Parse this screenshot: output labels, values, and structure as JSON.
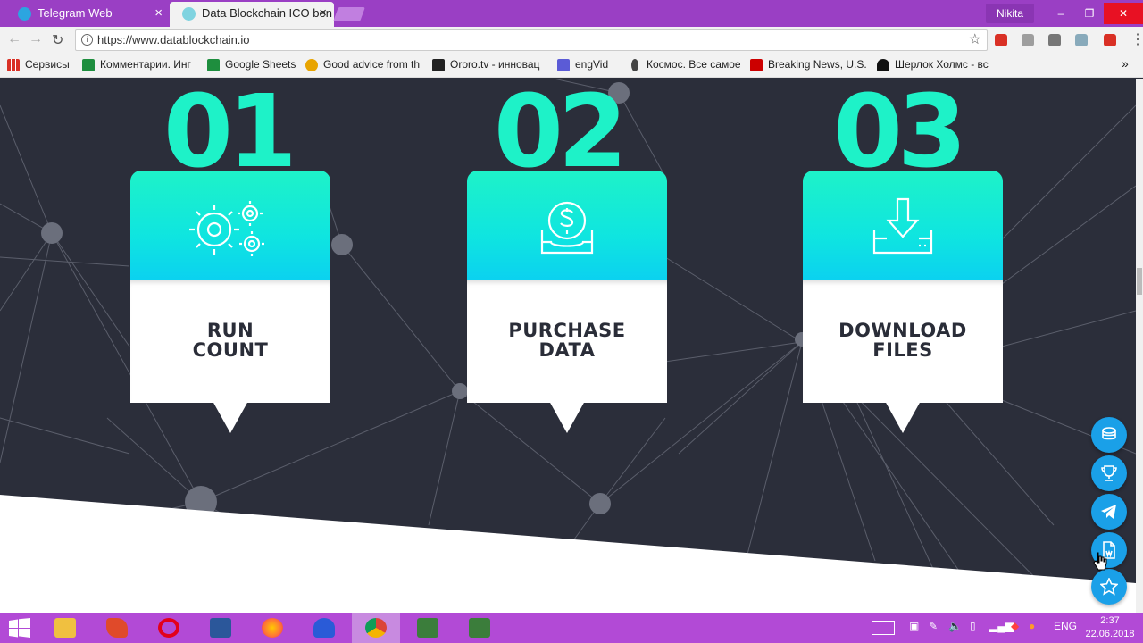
{
  "browser": {
    "tabs": [
      {
        "label": "Telegram Web",
        "close": "×",
        "icon_color": "#2ca5e0"
      },
      {
        "label": "Data Blockchain ICO ben",
        "close": "×",
        "icon_color": "#7fd3e0"
      }
    ],
    "user": "Nikita",
    "window_controls": {
      "minimize": "–",
      "restore": "❐",
      "close": "✕"
    },
    "url": "https://www.datablockchain.io",
    "bookmarks_apps": "Сервисы",
    "bookmarks": [
      {
        "label": "Комментарии. Инг",
        "icon_color": "#1e8e3e"
      },
      {
        "label": "Google Sheets",
        "icon_color": "#1e8e3e"
      },
      {
        "label": "Good advice from th",
        "icon_color": "#e8a400"
      },
      {
        "label": "Ororo.tv - инновац",
        "icon_color": "#222222"
      },
      {
        "label": "engVid",
        "icon_color": "#5b5bd6"
      },
      {
        "label": "Космос. Все самое",
        "icon_color": "#444444"
      },
      {
        "label": "Breaking News, U.S.",
        "icon_color": "#cc0000"
      },
      {
        "label": "Шерлок Холмс - вс",
        "icon_color": "#111111"
      }
    ],
    "more_bookmarks": "»"
  },
  "steps": [
    {
      "number": "01",
      "label_line1": "RUN",
      "label_line2": "COUNT",
      "icon": "gears-icon"
    },
    {
      "number": "02",
      "label_line1": "PURCHASE",
      "label_line2": "DATA",
      "icon": "dollar-inbox-icon"
    },
    {
      "number": "03",
      "label_line1": "DOWNLOAD",
      "label_line2": "FILES",
      "icon": "download-tray-icon"
    }
  ],
  "floating_buttons": [
    "coins-icon",
    "trophy-icon",
    "telegram-icon",
    "document-icon",
    "star-icon"
  ],
  "taskbar": {
    "apps": [
      "start-icon",
      "explorer-icon",
      "app-icon",
      "opera-icon",
      "word-icon",
      "firefox-icon",
      "app-icon",
      "chrome-icon",
      "camtasia-icon",
      "camtasia-icon"
    ],
    "language": "ENG",
    "time": "2:37",
    "date": "22.06.2018"
  },
  "colors": {
    "accent_teal": "#1ef2c8",
    "page_bg": "#2b2e3a",
    "fab_blue": "#1aa0e8",
    "titlebar_purple": "#9a3fc4",
    "taskbar_purple": "#b24ad6"
  }
}
